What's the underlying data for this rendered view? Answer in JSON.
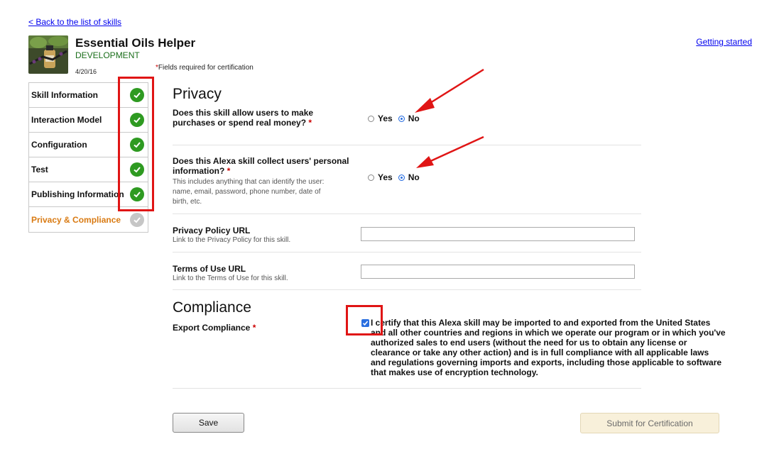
{
  "nav": {
    "back_link": "< Back to the list of skills",
    "getting_started": "Getting started"
  },
  "skill": {
    "name": "Essential Oils Helper",
    "stage": "DEVELOPMENT",
    "date": "4/20/16"
  },
  "required_note": {
    "star": "*",
    "text": "Fields required for certification"
  },
  "sidebar": {
    "items": [
      {
        "label": "Skill Information",
        "status": "complete"
      },
      {
        "label": "Interaction Model",
        "status": "complete"
      },
      {
        "label": "Configuration",
        "status": "complete"
      },
      {
        "label": "Test",
        "status": "complete"
      },
      {
        "label": "Publishing Information",
        "status": "complete"
      },
      {
        "label": "Privacy & Compliance",
        "status": "active"
      }
    ]
  },
  "privacy": {
    "title": "Privacy",
    "q1": {
      "label_line1": "Does this skill allow users to make",
      "label_line2": "purchases or spend real money?",
      "yes": "Yes",
      "no": "No",
      "selected": "No"
    },
    "q2": {
      "label_line1": "Does this Alexa skill collect users' personal",
      "label_line2": "information?",
      "help_line1": "This includes anything that can identify the user:",
      "help_line2": "name, email, password, phone number, date of",
      "help_line3": "birth, etc.",
      "yes": "Yes",
      "no": "No",
      "selected": "No"
    },
    "policy_url": {
      "label": "Privacy Policy URL",
      "help": "Link to the Privacy Policy for this skill.",
      "value": ""
    },
    "terms_url": {
      "label": "Terms of Use URL",
      "help": "Link to the Terms of Use for this skill.",
      "value": ""
    }
  },
  "compliance": {
    "title": "Compliance",
    "export_label": "Export Compliance",
    "checked": true,
    "text_lines": [
      "I certify that this Alexa skill may be imported to and exported from the United States",
      "and all other countries and regions in which we operate our program or in which you've",
      "authorized sales to end users (without the need for us to obtain any license or",
      "clearance or take any other action) and is in full compliance with all applicable laws",
      "and regulations governing imports and exports, including those applicable to software",
      "that makes use of encryption technology."
    ]
  },
  "buttons": {
    "save": "Save",
    "submit": "Submit for Certification"
  },
  "colors": {
    "check_green": "#2e9a21",
    "annotation_red": "#e01515",
    "active_orange": "#d97a12",
    "link_blue": "#0000ee"
  }
}
